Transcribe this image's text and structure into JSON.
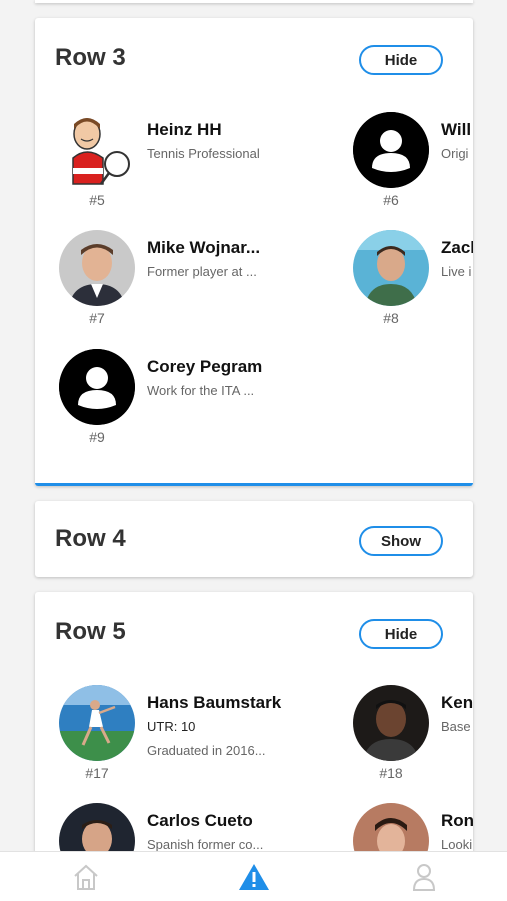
{
  "rows": [
    {
      "title": "Row 3",
      "toggle_label": "Hide",
      "players": [
        {
          "name": "Heinz HH",
          "desc": "Tennis Professional",
          "rank": "#5",
          "avatar": "cartoon-avatar"
        },
        {
          "name": "Will",
          "desc": "Origi",
          "rank": "#6",
          "avatar": "default-avatar"
        },
        {
          "name": "Mike Wojnar...",
          "desc": "Former player at ...",
          "rank": "#7",
          "avatar": "photo-avatar"
        },
        {
          "name": "Zacl",
          "desc": "Live i",
          "rank": "#8",
          "avatar": "photo-avatar"
        },
        {
          "name": "Corey Pegram",
          "desc": "Work for the ITA ...",
          "rank": "#9",
          "avatar": "default-avatar"
        }
      ]
    },
    {
      "title": "Row 4",
      "toggle_label": "Show"
    },
    {
      "title": "Row 5",
      "toggle_label": "Hide",
      "players": [
        {
          "name": "Hans Baumstark",
          "utr": "UTR: 10",
          "desc": "Graduated in 2016...",
          "rank": "#17",
          "avatar": "photo-avatar"
        },
        {
          "name": "Ken",
          "desc": "Base",
          "rank": "#18",
          "avatar": "photo-avatar"
        },
        {
          "name": "Carlos Cueto",
          "desc": "Spanish former co...",
          "avatar": "photo-avatar"
        },
        {
          "name": "Ron",
          "desc": "Looki",
          "avatar": "photo-avatar"
        }
      ]
    }
  ],
  "nav": {
    "items": [
      "home-icon",
      "alert-icon",
      "profile-icon"
    ],
    "active_color": "#1f8ee8",
    "inactive_color": "#c8c8c8"
  },
  "accent_color": "#1f8ee8"
}
